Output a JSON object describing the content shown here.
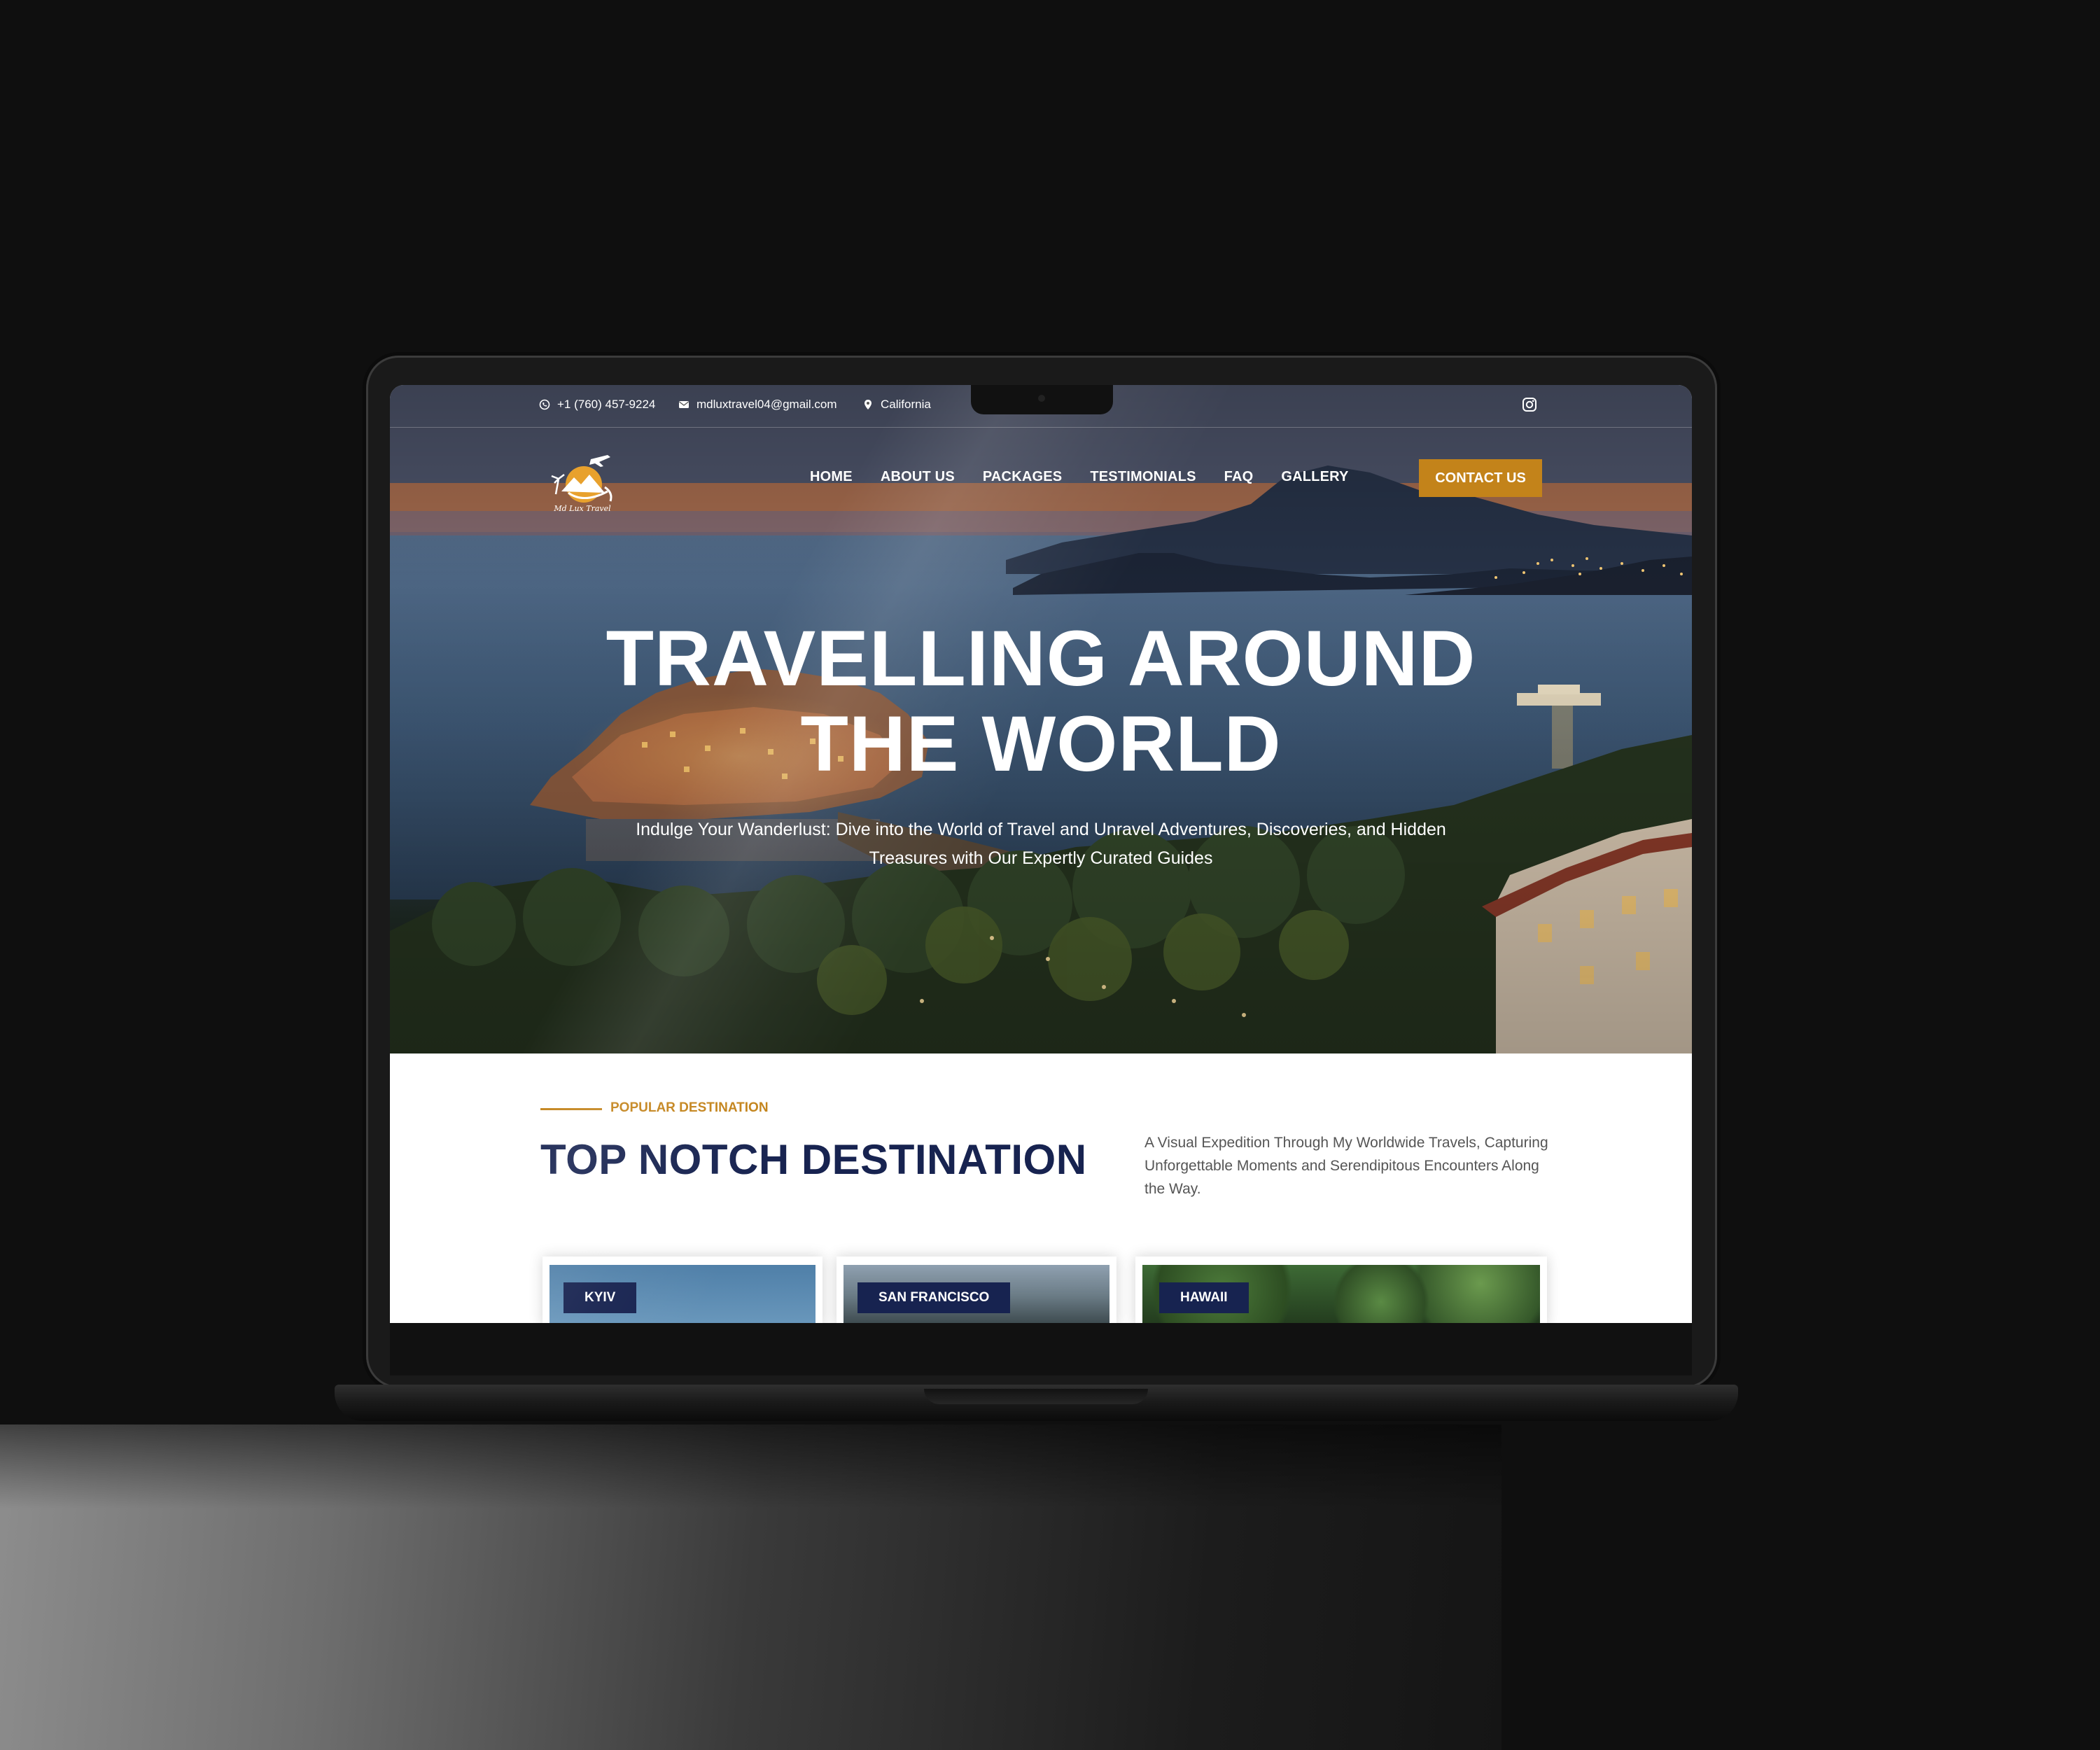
{
  "topbar": {
    "phone": "+1 (760) 457-9224",
    "email": "mdluxtravel04@gmail.com",
    "location": "California"
  },
  "brand": {
    "logo_text": "Md Lux Travel"
  },
  "nav": {
    "items": [
      "HOME",
      "ABOUT US",
      "PACKAGES",
      "TESTIMONIALS",
      "FAQ",
      "GALLERY"
    ],
    "cta": "CONTACT US"
  },
  "hero": {
    "title_line1": "TRAVELLING AROUND",
    "title_line2": "THE WORLD",
    "subtitle_line1": "Indulge Your Wanderlust: Dive into the World of Travel and Unravel Adventures, Discoveries, and Hidden",
    "subtitle_line2": "Treasures with Our Expertly Curated Guides"
  },
  "destinations": {
    "eyebrow": "POPULAR DESTINATION",
    "title": "TOP NOTCH DESTINATION",
    "description": "A Visual Expedition Through My Worldwide Travels, Capturing Unforgettable Moments and Serendipitous Encounters Along the Way.",
    "cards": [
      "KYIV",
      "SAN FRANCISCO",
      "HAWAII"
    ]
  },
  "colors": {
    "accent": "#c3831a",
    "navy": "#172350",
    "background": "#0f0f0f"
  }
}
